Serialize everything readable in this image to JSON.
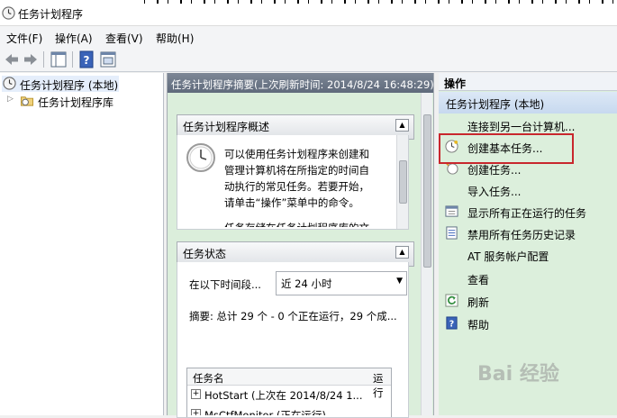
{
  "window": {
    "title": "任务计划程序"
  },
  "menubar": [
    "文件(F)",
    "操作(A)",
    "查看(V)",
    "帮助(H)"
  ],
  "tree": {
    "root": "任务计划程序 (本地)",
    "child": "任务计划程序库"
  },
  "middle": {
    "header": "任务计划程序摘要(上次刷新时间: 2014/8/24 16:48:29)",
    "overview": {
      "title": "任务计划程序概述",
      "lines": [
        "可以使用任务计划程序来创建和",
        "管理计算机将在所指定的时间自",
        "动执行的常见任务。若要开始，",
        "请单击“操作”菜单中的命令。"
      ],
      "cut_line": "任务存储在任务计划程序库的文"
    },
    "status": {
      "title": "任务状态",
      "period_label": "在以下时间段...",
      "period_value": "近 24 小时",
      "summary": "摘要: 总计 29 个 - 0 个正在运行，29 个成...",
      "col_task": "任务名",
      "col_run": "运行",
      "rows": [
        "HotStart (上次在 2014/8/24 1...",
        "MsCtfMonitor (正在运行)"
      ]
    }
  },
  "actions": {
    "header": "操作",
    "group": "任务计划程序 (本地)",
    "items": [
      {
        "label": "连接到另一台计算机...",
        "icon": "none"
      },
      {
        "label": "创建基本任务...",
        "icon": "clock-wizard-icon"
      },
      {
        "label": "创建任务...",
        "icon": "create-task-icon"
      },
      {
        "label": "导入任务...",
        "icon": "none"
      },
      {
        "label": "显示所有正在运行的任务",
        "icon": "running-tasks-icon"
      },
      {
        "label": "禁用所有任务历史记录",
        "icon": "history-icon"
      },
      {
        "label": "AT 服务帐户配置",
        "icon": "none"
      },
      {
        "label": "查看",
        "icon": "none"
      },
      {
        "label": "刷新",
        "icon": "refresh-icon"
      },
      {
        "label": "帮助",
        "icon": "help-icon"
      }
    ]
  },
  "watermark": "Bai 经验"
}
